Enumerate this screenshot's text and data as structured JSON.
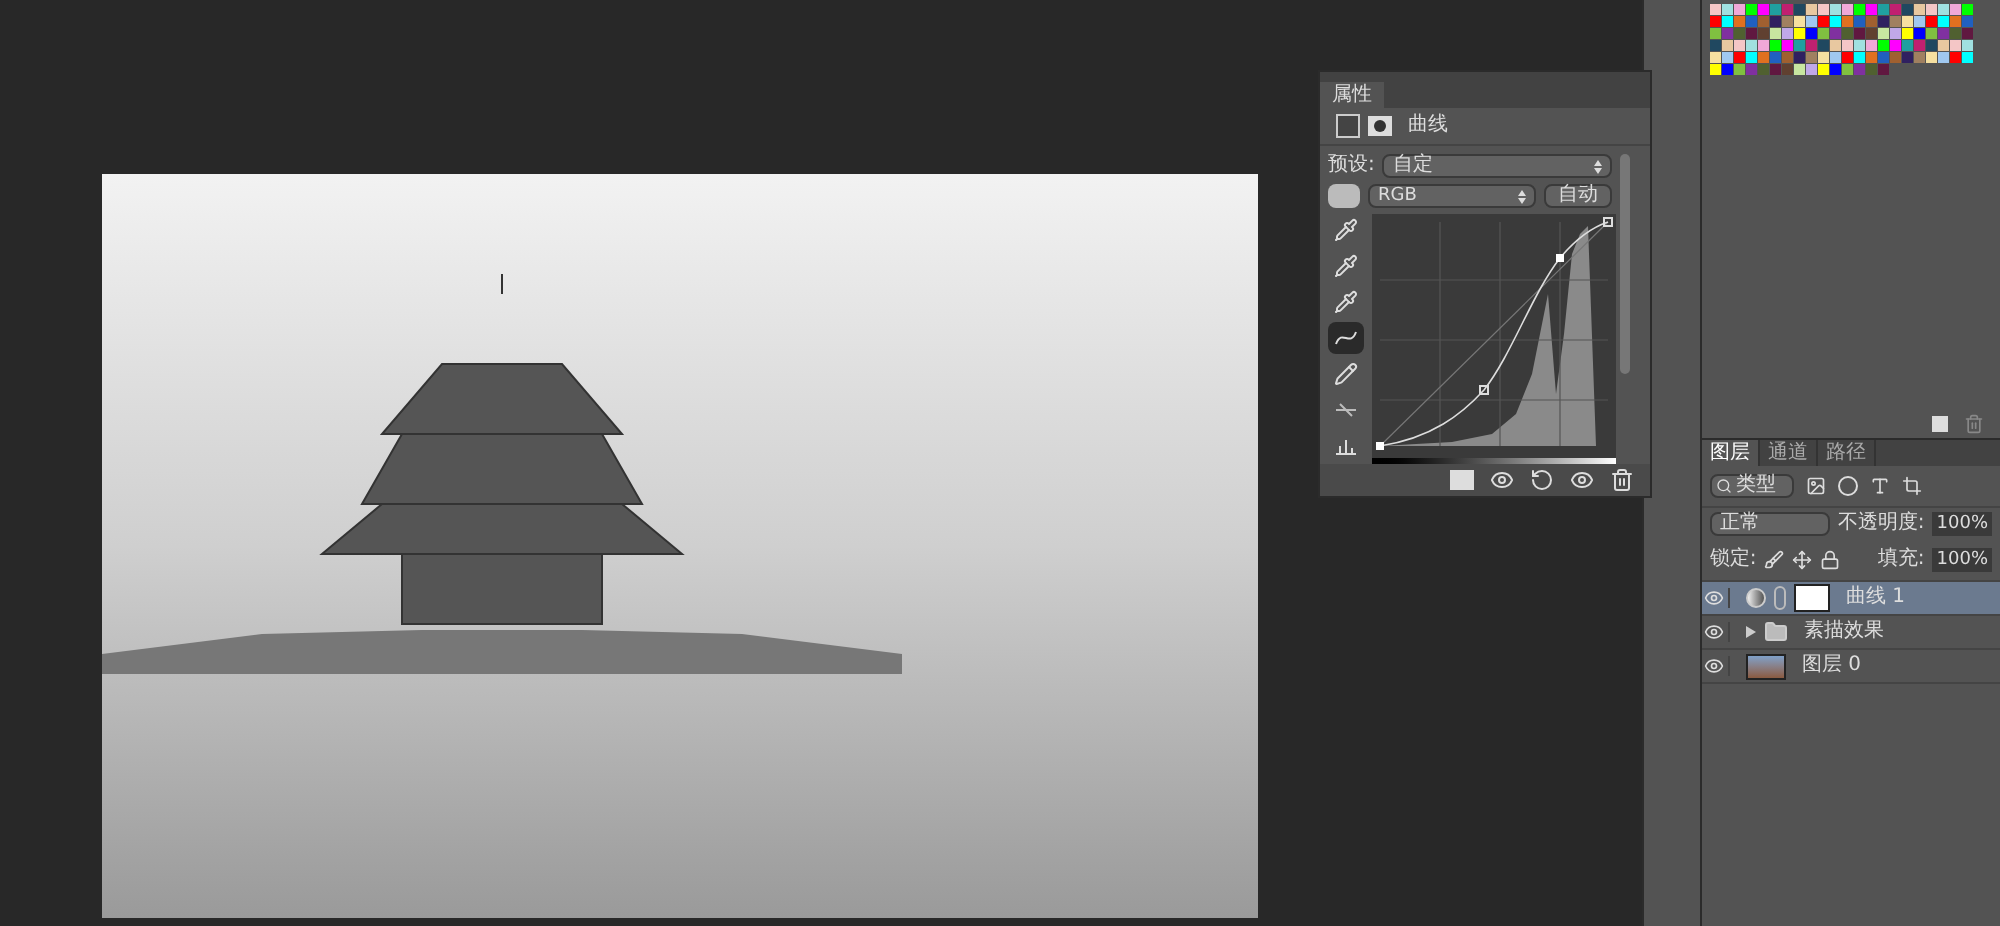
{
  "properties_panel": {
    "tab": "属性",
    "adjustment_title": "曲线",
    "preset_label": "预设:",
    "preset_value": "自定",
    "channel_value": "RGB",
    "auto_button": "自动",
    "tools": [
      {
        "kind": "eyedropper-dark",
        "selected": false
      },
      {
        "kind": "eyedropper-mid",
        "selected": false
      },
      {
        "kind": "eyedropper-light",
        "selected": false
      },
      {
        "kind": "curve",
        "selected": true
      },
      {
        "kind": "pencil",
        "selected": false
      },
      {
        "kind": "smooth",
        "selected": false
      },
      {
        "kind": "clip",
        "selected": false
      }
    ]
  },
  "layers_panel": {
    "tabs": [
      {
        "label": "图层",
        "selected": true
      },
      {
        "label": "通道",
        "selected": false
      },
      {
        "label": "路径",
        "selected": false
      }
    ],
    "filter_kind": "类型",
    "blend_mode": "正常",
    "opacity_label": "不透明度:",
    "opacity_value": "100%",
    "lock_label": "锁定:",
    "fill_label": "填充:",
    "fill_value": "100%",
    "layers": [
      {
        "kind": "adjustment",
        "name": "曲线 1",
        "selected": true,
        "visible": true
      },
      {
        "kind": "group",
        "name": "素描效果",
        "selected": false,
        "visible": true
      },
      {
        "kind": "image",
        "name": "图层 0",
        "selected": false,
        "visible": true
      }
    ]
  }
}
